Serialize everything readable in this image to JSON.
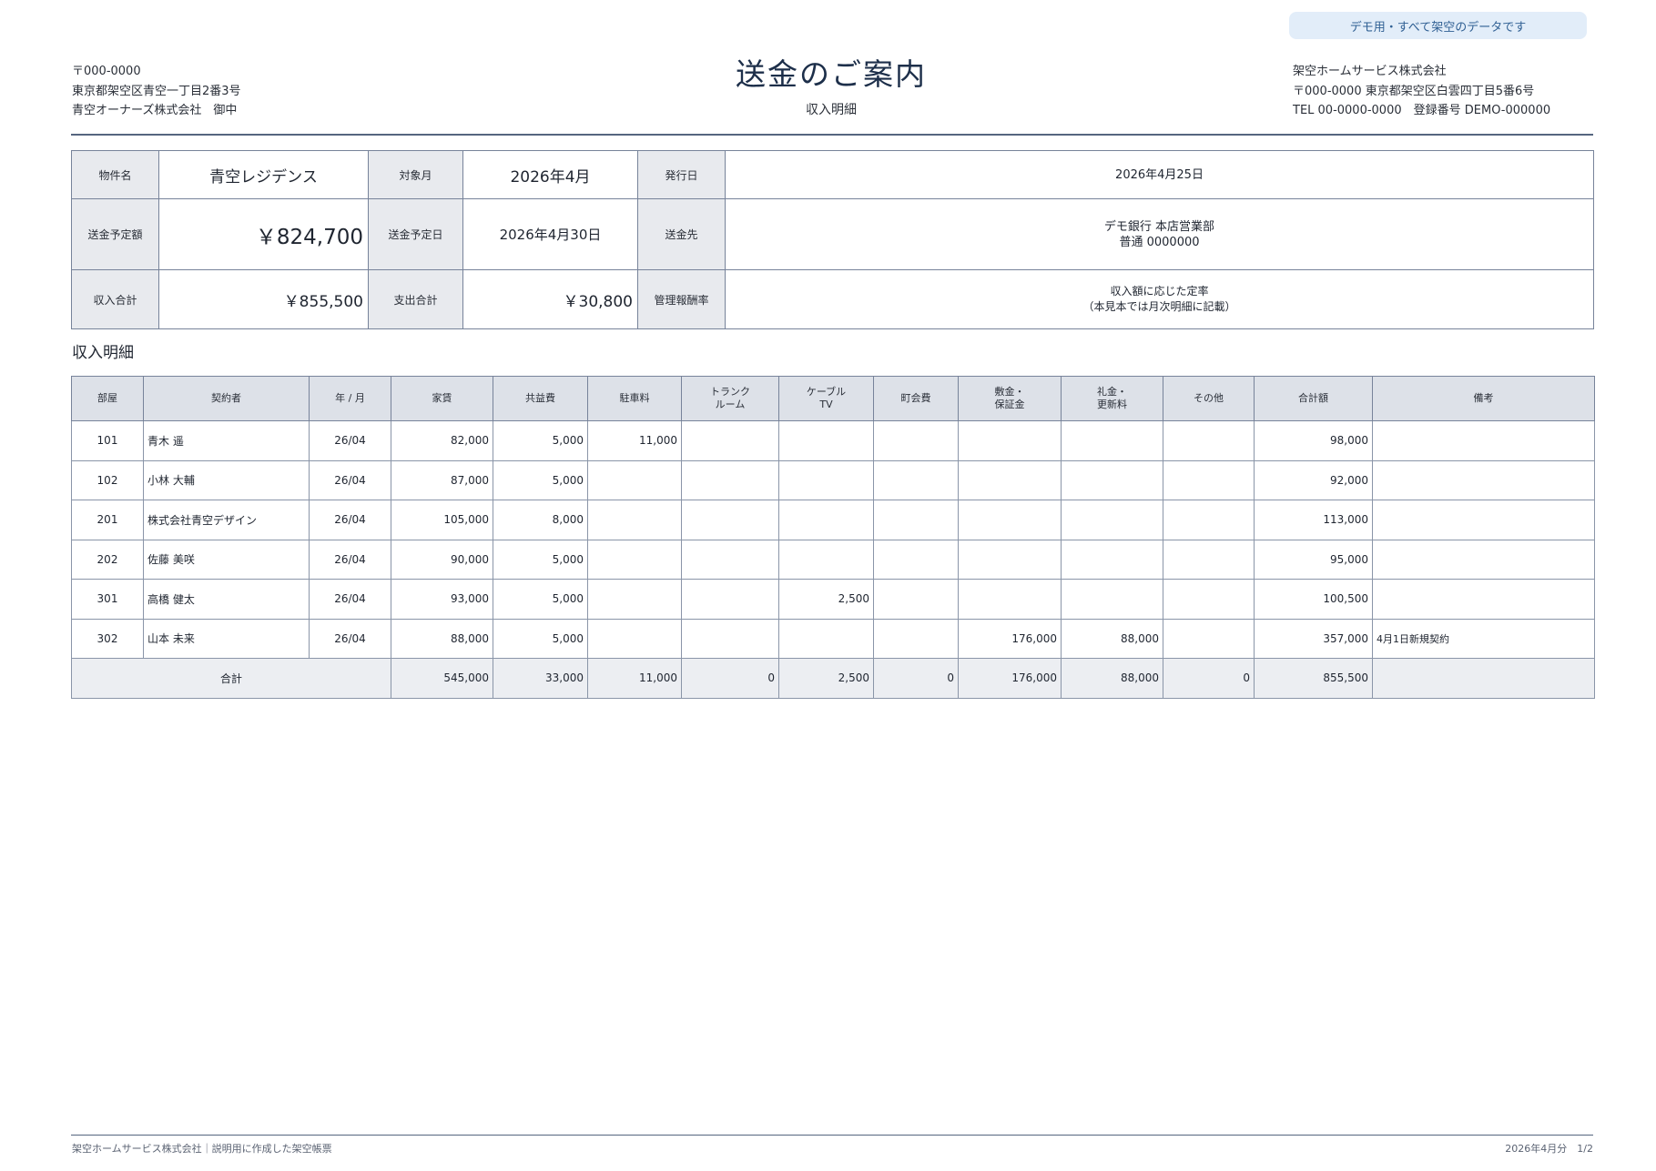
{
  "badge": "デモ用・すべて架空のデータです",
  "recipient": {
    "postal": "〒000-0000",
    "address": "東京都架空区青空一丁目2番3号",
    "name": "青空オーナーズ株式会社　御中"
  },
  "title": "送金のご案内",
  "subtitle": "収入明細",
  "issuer": {
    "name": "架空ホームサービス株式会社",
    "address": "〒000-0000 東京都架空区白雲四丁目5番6号",
    "contact": "TEL 00-0000-0000　登録番号 DEMO-000000"
  },
  "summary": {
    "property_label": "物件名",
    "property": "青空レジデンス",
    "month_label": "対象月",
    "month": "2026年4月",
    "issue_label": "発行日",
    "issue_date": "2026年4月25日",
    "remit_amount_label": "送金予定額",
    "remit_amount": "￥824,700",
    "remit_date_label": "送金予定日",
    "remit_date": "2026年4月30日",
    "dest_label": "送金先",
    "dest_line1": "デモ銀行 本店営業部",
    "dest_line2": "普通 0000000",
    "income_total_label": "収入合計",
    "income_total": "￥855,500",
    "expense_total_label": "支出合計",
    "expense_total": "￥30,800",
    "fee_rate_label": "管理報酬率",
    "fee_rate_line1": "収入額に応じた定率",
    "fee_rate_line2": "（本見本では月次明細に記載）"
  },
  "section_title": "収入明細",
  "detail": {
    "headers": {
      "room": "部屋",
      "tenant": "契約者",
      "ym": "年 / 月",
      "rent": "家賃",
      "common": "共益費",
      "parking": "駐車料",
      "trunk_1": "トランク",
      "trunk_2": "ルーム",
      "cable_1": "ケーブル",
      "cable_2": "TV",
      "town": "町会費",
      "deposit_1": "敷金・",
      "deposit_2": "保証金",
      "key_1": "礼金・",
      "key_2": "更新料",
      "other": "その他",
      "total": "合計額",
      "note": "備考"
    },
    "rows": [
      {
        "room": "101",
        "tenant": "青木 遥",
        "ym": "26/04",
        "rent": "82,000",
        "common": "5,000",
        "parking": "11,000",
        "trunk": "",
        "cable": "",
        "town": "",
        "deposit": "",
        "key": "",
        "other": "",
        "total": "98,000",
        "note": ""
      },
      {
        "room": "102",
        "tenant": "小林 大輔",
        "ym": "26/04",
        "rent": "87,000",
        "common": "5,000",
        "parking": "",
        "trunk": "",
        "cable": "",
        "town": "",
        "deposit": "",
        "key": "",
        "other": "",
        "total": "92,000",
        "note": ""
      },
      {
        "room": "201",
        "tenant": "株式会社青空デザイン",
        "ym": "26/04",
        "rent": "105,000",
        "common": "8,000",
        "parking": "",
        "trunk": "",
        "cable": "",
        "town": "",
        "deposit": "",
        "key": "",
        "other": "",
        "total": "113,000",
        "note": ""
      },
      {
        "room": "202",
        "tenant": "佐藤 美咲",
        "ym": "26/04",
        "rent": "90,000",
        "common": "5,000",
        "parking": "",
        "trunk": "",
        "cable": "",
        "town": "",
        "deposit": "",
        "key": "",
        "other": "",
        "total": "95,000",
        "note": ""
      },
      {
        "room": "301",
        "tenant": "高橋 健太",
        "ym": "26/04",
        "rent": "93,000",
        "common": "5,000",
        "parking": "",
        "trunk": "",
        "cable": "2,500",
        "town": "",
        "deposit": "",
        "key": "",
        "other": "",
        "total": "100,500",
        "note": ""
      },
      {
        "room": "302",
        "tenant": "山本 未来",
        "ym": "26/04",
        "rent": "88,000",
        "common": "5,000",
        "parking": "",
        "trunk": "",
        "cable": "",
        "town": "",
        "deposit": "176,000",
        "key": "88,000",
        "other": "",
        "total": "357,000",
        "note": "4月1日新規契約"
      }
    ],
    "totals": {
      "label": "合計",
      "rent": "545,000",
      "common": "33,000",
      "parking": "11,000",
      "trunk": "0",
      "cable": "2,500",
      "town": "0",
      "deposit": "176,000",
      "key": "88,000",
      "other": "0",
      "total": "855,500",
      "note": ""
    }
  },
  "footer": {
    "left": "架空ホームサービス株式会社｜説明用に作成した架空帳票",
    "right": "2026年4月分　1/2"
  }
}
